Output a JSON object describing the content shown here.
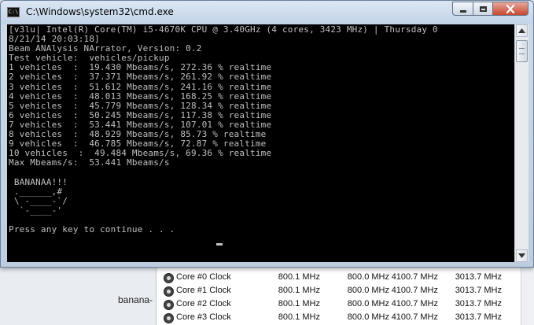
{
  "window": {
    "title": "C:\\Windows\\system32\\cmd.exe",
    "icon": "C:\\"
  },
  "console_lines": [
    "[v3lu| Intel(R) Core(TM) i5-4670K CPU @ 3.40GHz (4 cores, 3423 MHz) | Thursday 0",
    "8/21/14 20:03:18]",
    "Beam ANAlysis NArrator, Version: 0.2",
    "Test vehicle:  vehicles/pickup",
    "1 vehicles  :  19.430 Mbeams/s, 272.36 % realtime",
    "2 vehicles  :  37.371 Mbeams/s, 261.92 % realtime",
    "3 vehicles  :  51.612 Mbeams/s, 241.16 % realtime",
    "4 vehicles  :  48.013 Mbeams/s, 168.25 % realtime",
    "5 vehicles  :  45.779 Mbeams/s, 128.34 % realtime",
    "6 vehicles  :  50.245 Mbeams/s, 117.38 % realtime",
    "7 vehicles  :  53.441 Mbeams/s, 107.01 % realtime",
    "8 vehicles  :  48.929 Mbeams/s, 85.73 % realtime",
    "9 vehicles  :  46.785 Mbeams/s, 72.87 % realtime",
    "10 vehicles  :  49.484 Mbeams/s, 69.36 % realtime",
    "Max Mbeams/s:  53.441 Mbeams/s",
    "",
    " BANANAA!!!",
    " .______,#",
    " \\ -____-`/",
    "  `-____-'",
    "",
    "Press any key to continue . . . "
  ],
  "background": {
    "left_label": "banana-",
    "rows": [
      {
        "name": "Core #0 Clock",
        "cur": "800.1 MHz",
        "min": "800.0 MHz",
        "max": "4100.7 MHz",
        "avg": "3013.7 MHz"
      },
      {
        "name": "Core #1 Clock",
        "cur": "800.1 MHz",
        "min": "800.0 MHz",
        "max": "4100.7 MHz",
        "avg": "3013.7 MHz"
      },
      {
        "name": "Core #2 Clock",
        "cur": "800.1 MHz",
        "min": "800.0 MHz",
        "max": "4100.7 MHz",
        "avg": "3013.7 MHz"
      },
      {
        "name": "Core #3 Clock",
        "cur": "800.1 MHz",
        "min": "800.0 MHz",
        "max": "4100.7 MHz",
        "avg": "3013.7 MHz"
      }
    ]
  },
  "colors": {
    "console_bg": "#000000",
    "console_fg": "#c0c0c0",
    "close_button": "#c7482f"
  },
  "icons": {
    "minimize": "minimize-icon",
    "maximize": "maximize-icon",
    "close": "close-icon",
    "sensor": "clock-sensor-icon"
  }
}
